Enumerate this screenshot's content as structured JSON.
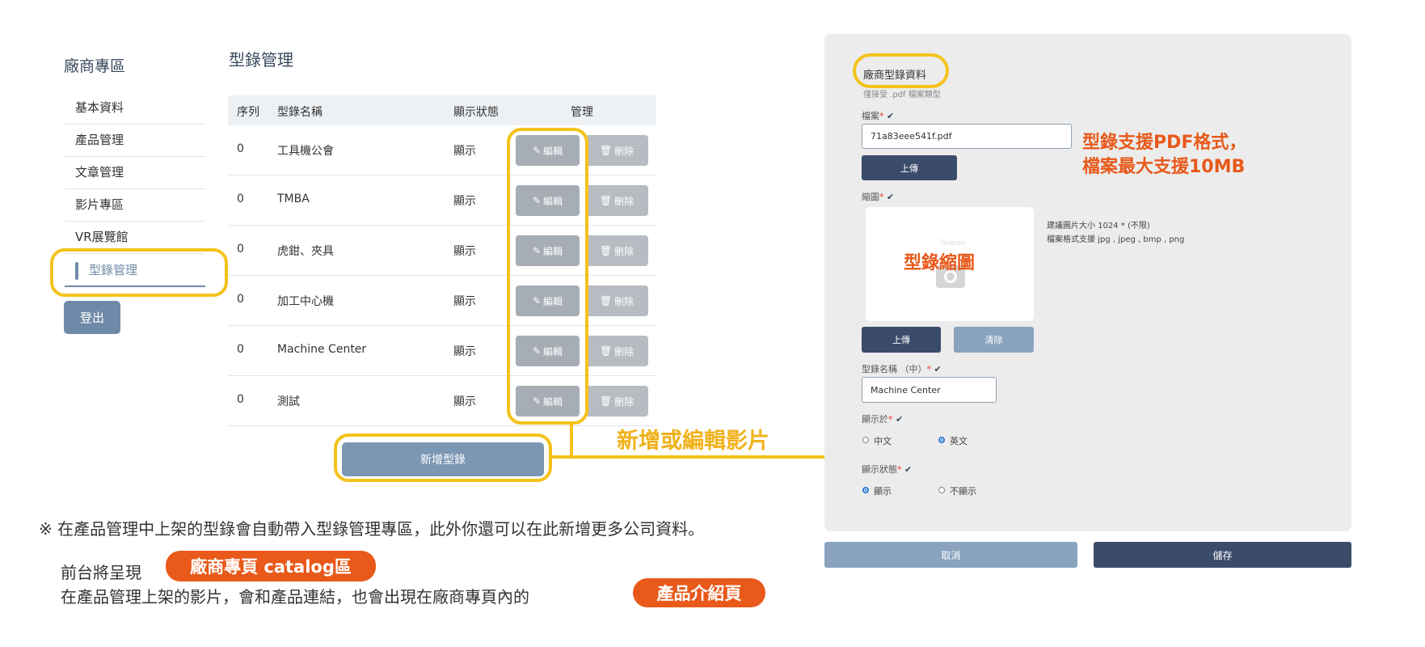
{
  "sidebar": {
    "title": "廠商專區",
    "items": [
      {
        "label": "基本資料"
      },
      {
        "label": "產品管理"
      },
      {
        "label": "文章管理"
      },
      {
        "label": "影片專區"
      },
      {
        "label": "VR展覽館"
      },
      {
        "label": "型錄管理"
      }
    ],
    "logout": "登出"
  },
  "main": {
    "title": "型錄管理",
    "columns": [
      "序列",
      "型錄名稱",
      "顯示狀態",
      "管理"
    ],
    "rows": [
      {
        "seq": "0",
        "name": "工具機公會",
        "status": "顯示"
      },
      {
        "seq": "0",
        "name": "TMBA",
        "status": "顯示"
      },
      {
        "seq": "0",
        "name": "虎鉗、夾具",
        "status": "顯示"
      },
      {
        "seq": "0",
        "name": "加工中心機",
        "status": "顯示"
      },
      {
        "seq": "0",
        "name": "Machine Center",
        "status": "顯示"
      },
      {
        "seq": "0",
        "name": "測試",
        "status": "顯示"
      }
    ],
    "edit_label": "編輯",
    "delete_label": "刪除",
    "add_button": "新增型錄"
  },
  "annotations": {
    "add_edit": "新增或編輯影片",
    "pdf_line1": "型錄支援PDF格式，",
    "pdf_line2": "檔案最大支援10MB",
    "thumb": "型錄縮圖"
  },
  "notes": {
    "line1": "※ 在產品管理中上架的型錄會自動帶入型錄管理專區，此外你還可以在此新增更多公司資料。",
    "line2_prefix": "前台將呈現",
    "pill1": "廠商專頁 catalog區",
    "line3_prefix": "在產品管理上架的影片，會和產品連結，也會出現在廠商專頁內的",
    "pill2": "產品介紹頁"
  },
  "form": {
    "title": "廠商型錄資料",
    "subtitle": "僅接受 .pdf 檔案類型",
    "file_label": "檔案",
    "file_value": "71a83eee541f.pdf",
    "upload": "上傳",
    "thumb_label": "縮圖",
    "thumb_hint1": "建議圖片大小 1024 * (不限)",
    "thumb_hint2": "檔案格式支援 jpg , jpeg , bmp , png",
    "thumb_placeholder": "Taiwan",
    "clear": "清除",
    "name_label": "型錄名稱 （中）",
    "name_value": "Machine Center",
    "display_in_label": "顯示於",
    "lang_zh": "中文",
    "lang_en": "英文",
    "status_label": "顯示狀態",
    "status_show": "顯示",
    "status_hide": "不顯示",
    "required_mark": "*",
    "check_mark": "✔",
    "cancel": "取消",
    "save": "儲存"
  },
  "colors": {
    "highlight": "#f4c21a",
    "accent_orange": "#e8591a",
    "button_blue": "#6f8aa8",
    "button_dark": "#3b4c6b"
  }
}
